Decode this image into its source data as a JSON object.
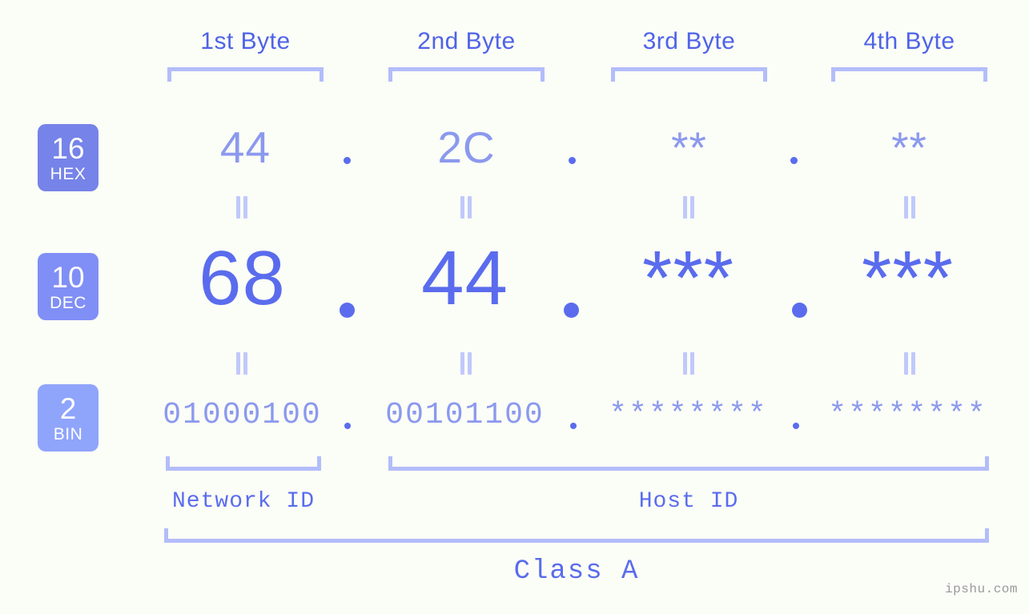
{
  "watermark": "ipshu.com",
  "columns": [
    {
      "header": "1st Byte"
    },
    {
      "header": "2nd Byte"
    },
    {
      "header": "3rd Byte"
    },
    {
      "header": "4th Byte"
    }
  ],
  "bases": [
    {
      "num": "16",
      "name": "HEX",
      "color": "#7683e8"
    },
    {
      "num": "10",
      "name": "DEC",
      "color": "#808ff5"
    },
    {
      "num": "2",
      "name": "BIN",
      "color": "#8fa4fb"
    }
  ],
  "rows": {
    "hex": {
      "base": "16",
      "label": "HEX",
      "values": [
        "44",
        "2C",
        "**",
        "**"
      ]
    },
    "dec": {
      "base": "10",
      "label": "DEC",
      "values": [
        "68",
        "44",
        "***",
        "***"
      ]
    },
    "bin": {
      "base": "2",
      "label": "BIN",
      "values": [
        "01000100",
        "00101100",
        "********",
        "********"
      ]
    }
  },
  "separator": ".",
  "segments": [
    {
      "label": "Network ID"
    },
    {
      "label": "Host ID"
    }
  ],
  "class": {
    "label": "Class A"
  },
  "colors": {
    "background": "#fbfdf7",
    "header_text": "#4f63e8",
    "bracket": "#b3bdfa",
    "hex_text": "#8b99ee",
    "dec_text": "#5a6ced",
    "bin_text": "#8b99ee",
    "connector": "#c0c9fb",
    "watermark_text": "#9a9a9a"
  }
}
